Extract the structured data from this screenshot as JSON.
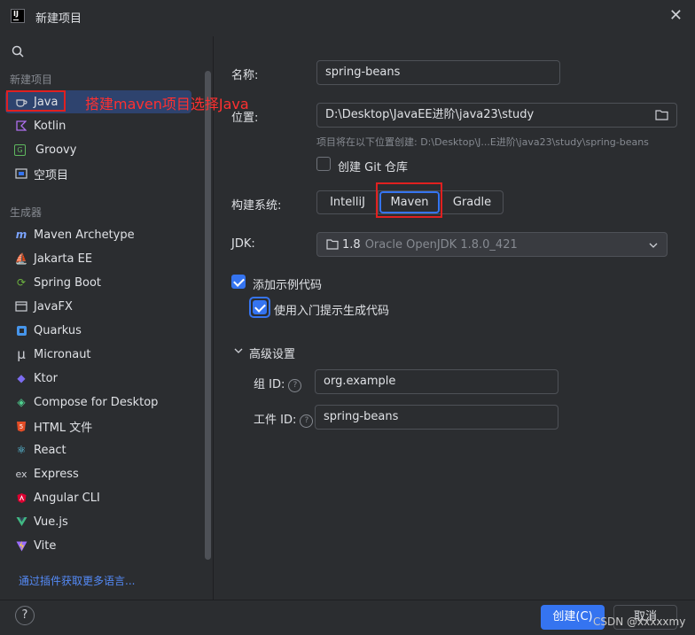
{
  "window": {
    "title": "新建项目",
    "close_glyph": "✕"
  },
  "sidebar": {
    "section_new": "新建项目",
    "section_generators": "生成器",
    "items": [
      {
        "label": "Java",
        "icon": "java-cup-icon"
      },
      {
        "label": "Kotlin",
        "icon": "kotlin-icon"
      },
      {
        "label": "Groovy",
        "icon": "groovy-icon"
      },
      {
        "label": "空项目",
        "icon": "folder-icon"
      }
    ],
    "generators": [
      {
        "label": "Maven Archetype",
        "icon": "maven-icon"
      },
      {
        "label": "Jakarta EE",
        "icon": "jakarta-icon"
      },
      {
        "label": "Spring Boot",
        "icon": "spring-icon"
      },
      {
        "label": "JavaFX",
        "icon": "javafx-icon"
      },
      {
        "label": "Quarkus",
        "icon": "quarkus-icon"
      },
      {
        "label": "Micronaut",
        "icon": "micronaut-icon"
      },
      {
        "label": "Ktor",
        "icon": "ktor-icon"
      },
      {
        "label": "Compose for Desktop",
        "icon": "compose-icon"
      },
      {
        "label": "HTML 文件",
        "icon": "html5-icon"
      },
      {
        "label": "React",
        "icon": "react-icon"
      },
      {
        "label": "Express",
        "icon": "express-icon"
      },
      {
        "label": "Angular CLI",
        "icon": "angular-icon"
      },
      {
        "label": "Vue.js",
        "icon": "vue-icon"
      },
      {
        "label": "Vite",
        "icon": "vite-icon"
      }
    ],
    "plugin_link": "通过插件获取更多语言..."
  },
  "annotation": "搭建maven项目选择Java",
  "form": {
    "name_label": "名称:",
    "name_value": "spring-beans",
    "location_label": "位置:",
    "location_value": "D:\\Desktop\\JavaEE进阶\\java23\\study",
    "location_hint": "项目将在以下位置创建: D:\\Desktop\\J...E进阶\\java23\\study\\spring-beans",
    "git_label": "创建 Git 仓库",
    "git_checked": false,
    "build_label": "构建系统:",
    "build_options": [
      "IntelliJ",
      "Maven",
      "Gradle"
    ],
    "build_selected": "Maven",
    "jdk_label": "JDK:",
    "jdk_version": "1.8",
    "jdk_name": "Oracle OpenJDK 1.8.0_421",
    "sample_code_label": "添加示例代码",
    "sample_code_checked": true,
    "onboarding_label": "使用入门提示生成代码",
    "onboarding_checked": true,
    "advanced_label": "高级设置",
    "group_label": "组 ID:",
    "group_value": "org.example",
    "artifact_label": "工件 ID:",
    "artifact_value": "spring-beans"
  },
  "footer": {
    "help": "?",
    "create": "创建(C)",
    "cancel": "取消"
  },
  "watermark": "CSDN @xxxxxmy",
  "colors": {
    "accent": "#3574f0",
    "selection": "#2e436e",
    "annotation_red": "#e02020"
  }
}
